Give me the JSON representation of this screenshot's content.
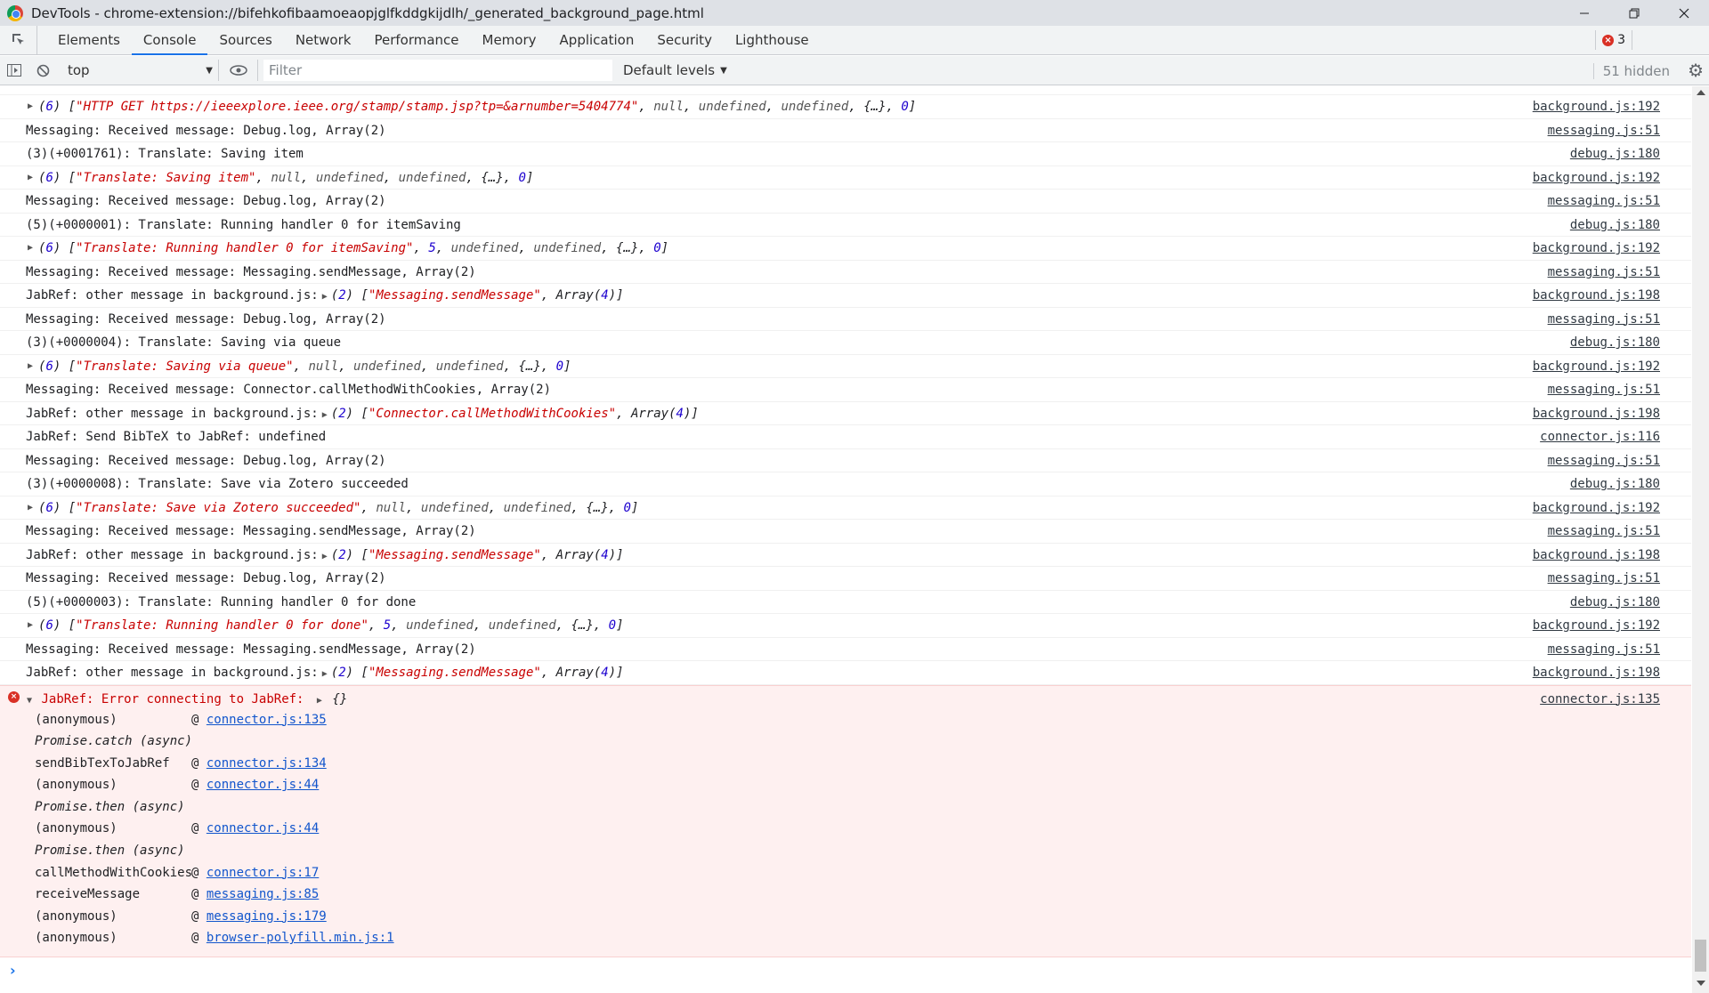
{
  "window": {
    "title": "DevTools - chrome-extension://bifehkofibaamoeaopjglfkddgkijdlh/_generated_background_page.html",
    "minimize_icon": "minimize-icon",
    "maximize_icon": "restore-icon",
    "close_icon": "close-icon"
  },
  "tabs": [
    {
      "label": "Elements"
    },
    {
      "label": "Console",
      "active": true
    },
    {
      "label": "Sources"
    },
    {
      "label": "Network"
    },
    {
      "label": "Performance"
    },
    {
      "label": "Memory"
    },
    {
      "label": "Application"
    },
    {
      "label": "Security"
    },
    {
      "label": "Lighthouse"
    }
  ],
  "error_count": "3",
  "toolbar": {
    "context": "top",
    "filter_placeholder": "Filter",
    "levels": "Default levels",
    "hidden": "51 hidden"
  },
  "messages": [
    {
      "type": "expander",
      "text": "(6) [\"HTTP GET https://ieeexplore.ieee.org/stamp/stamp.jsp?tp=&arnumber=5404774\", null, undefined, undefined, {…}, 0]",
      "src": "background.js:192"
    },
    {
      "type": "log",
      "text": "Messaging: Received message: Debug.log, Array(2)",
      "src": "messaging.js:51"
    },
    {
      "type": "log",
      "text": "(3)(+0001761): Translate: Saving item",
      "src": "debug.js:180"
    },
    {
      "type": "expander",
      "text": "(6) [\"Translate: Saving item\", null, undefined, undefined, {…}, 0]",
      "src": "background.js:192"
    },
    {
      "type": "log",
      "text": "Messaging: Received message: Debug.log, Array(2)",
      "src": "messaging.js:51"
    },
    {
      "type": "log",
      "text": "(5)(+0000001): Translate: Running handler 0 for itemSaving",
      "src": "debug.js:180"
    },
    {
      "type": "expander",
      "text": "(6) [\"Translate: Running handler 0 for itemSaving\", 5, undefined, undefined, {…}, 0]",
      "src": "background.js:192"
    },
    {
      "type": "log",
      "text": "Messaging: Received message: Messaging.sendMessage, Array(2)",
      "src": "messaging.js:51"
    },
    {
      "type": "other",
      "prefix": "JabRef: other message in background.js:",
      "text": "(2) [\"Messaging.sendMessage\", Array(4)]",
      "src": "background.js:198"
    },
    {
      "type": "log",
      "text": "Messaging: Received message: Debug.log, Array(2)",
      "src": "messaging.js:51"
    },
    {
      "type": "log",
      "text": "(3)(+0000004): Translate: Saving via queue",
      "src": "debug.js:180"
    },
    {
      "type": "expander",
      "text": "(6) [\"Translate: Saving via queue\", null, undefined, undefined, {…}, 0]",
      "src": "background.js:192"
    },
    {
      "type": "log",
      "text": "Messaging: Received message: Connector.callMethodWithCookies, Array(2)",
      "src": "messaging.js:51"
    },
    {
      "type": "other",
      "prefix": "JabRef: other message in background.js:",
      "text": "(2) [\"Connector.callMethodWithCookies\", Array(4)]",
      "src": "background.js:198"
    },
    {
      "type": "log",
      "text": "JabRef: Send BibTeX to JabRef: undefined",
      "src": "connector.js:116"
    },
    {
      "type": "log",
      "text": "Messaging: Received message: Debug.log, Array(2)",
      "src": "messaging.js:51"
    },
    {
      "type": "log",
      "text": "(3)(+0000008): Translate: Save via Zotero succeeded",
      "src": "debug.js:180"
    },
    {
      "type": "expander",
      "text": "(6) [\"Translate: Save via Zotero succeeded\", null, undefined, undefined, {…}, 0]",
      "src": "background.js:192"
    },
    {
      "type": "log",
      "text": "Messaging: Received message: Messaging.sendMessage, Array(2)",
      "src": "messaging.js:51"
    },
    {
      "type": "other",
      "prefix": "JabRef: other message in background.js:",
      "text": "(2) [\"Messaging.sendMessage\", Array(4)]",
      "src": "background.js:198"
    },
    {
      "type": "log",
      "text": "Messaging: Received message: Debug.log, Array(2)",
      "src": "messaging.js:51"
    },
    {
      "type": "log",
      "text": "(5)(+0000003): Translate: Running handler 0 for done",
      "src": "debug.js:180"
    },
    {
      "type": "expander",
      "text": "(6) [\"Translate: Running handler 0 for done\", 5, undefined, undefined, {…}, 0]",
      "src": "background.js:192"
    },
    {
      "type": "log",
      "text": "Messaging: Received message: Messaging.sendMessage, Array(2)",
      "src": "messaging.js:51"
    },
    {
      "type": "other",
      "prefix": "JabRef: other message in background.js:",
      "text": "(2) [\"Messaging.sendMessage\", Array(4)]",
      "src": "background.js:198"
    }
  ],
  "error": {
    "message": "JabRef: Error connecting to JabRef:",
    "object": "{}",
    "src": "connector.js:135",
    "stack": [
      {
        "fn": "(anonymous)",
        "link": "connector.js:135"
      },
      {
        "fn": "Promise.catch (async)",
        "async": true
      },
      {
        "fn": "sendBibTexToJabRef",
        "link": "connector.js:134"
      },
      {
        "fn": "(anonymous)",
        "link": "connector.js:44"
      },
      {
        "fn": "Promise.then (async)",
        "async": true
      },
      {
        "fn": "(anonymous)",
        "link": "connector.js:44"
      },
      {
        "fn": "Promise.then (async)",
        "async": true
      },
      {
        "fn": "callMethodWithCookies",
        "link": "connector.js:17"
      },
      {
        "fn": "receiveMessage",
        "link": "messaging.js:85"
      },
      {
        "fn": "(anonymous)",
        "link": "messaging.js:179"
      },
      {
        "fn": "(anonymous)",
        "link": "browser-polyfill.min.js:1"
      }
    ]
  },
  "prompt_symbol": "›"
}
